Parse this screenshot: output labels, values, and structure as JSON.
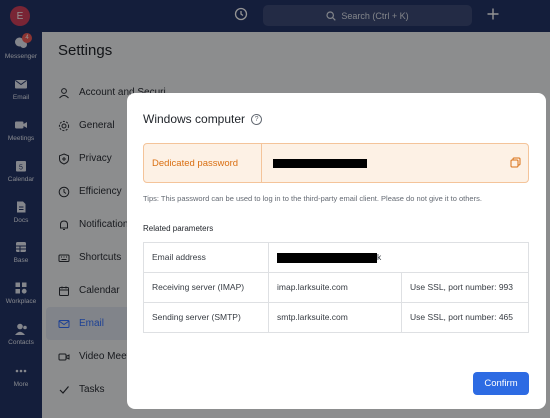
{
  "topbar": {
    "search_label": "Search (Ctrl + K)"
  },
  "rail": {
    "avatar_initial": "E",
    "items": [
      {
        "label": "Messenger",
        "icon": "messenger-icon",
        "badge": "4"
      },
      {
        "label": "Email",
        "icon": "email-icon"
      },
      {
        "label": "Meetings",
        "icon": "video-icon"
      },
      {
        "label": "Calendar",
        "icon": "calendar-icon",
        "glyph": "5"
      },
      {
        "label": "Docs",
        "icon": "docs-icon"
      },
      {
        "label": "Base",
        "icon": "base-icon"
      },
      {
        "label": "Workplace",
        "icon": "workplace-icon"
      },
      {
        "label": "Contacts",
        "icon": "contacts-icon"
      },
      {
        "label": "More",
        "icon": "more-icon"
      }
    ]
  },
  "settings": {
    "title": "Settings",
    "nav": [
      {
        "label": "Account and Security",
        "icon": "user-icon"
      },
      {
        "label": "General",
        "icon": "gear-icon"
      },
      {
        "label": "Privacy",
        "icon": "shield-icon"
      },
      {
        "label": "Efficiency",
        "icon": "efficiency-icon"
      },
      {
        "label": "Notifications",
        "icon": "bell-icon"
      },
      {
        "label": "Shortcuts",
        "icon": "keyboard-icon"
      },
      {
        "label": "Calendar",
        "icon": "calendar-icon"
      },
      {
        "label": "Email",
        "icon": "email-icon",
        "active": true
      },
      {
        "label": "Video Meetings",
        "icon": "video-icon"
      },
      {
        "label": "Tasks",
        "icon": "tasks-icon"
      }
    ]
  },
  "modal": {
    "title": "Windows computer",
    "password_label": "Dedicated password",
    "tips": "Tips: This password can be used to log in to the third-party email client. Please do not give it to others.",
    "related_title": "Related parameters",
    "rows": [
      {
        "label": "Email address",
        "value": "",
        "value_tail": "k",
        "extra": ""
      },
      {
        "label": "Receiving server (IMAP)",
        "value": "imap.larksuite.com",
        "extra": "Use SSL, port number: 993"
      },
      {
        "label": "Sending server (SMTP)",
        "value": "smtp.larksuite.com",
        "extra": "Use SSL, port number: 465"
      }
    ],
    "confirm_label": "Confirm"
  },
  "colors": {
    "rail_bg": "#243466",
    "accent": "#2d6be3",
    "password_bg": "#fdf1e5",
    "password_text": "#d96f12"
  }
}
